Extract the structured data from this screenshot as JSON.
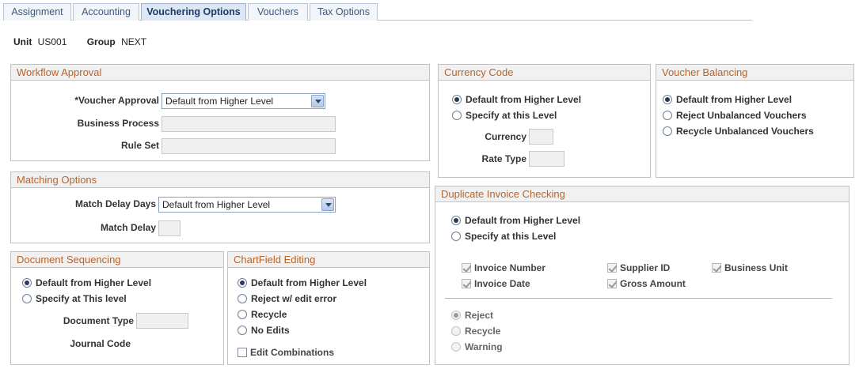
{
  "tabs": [
    {
      "label": "Assignment"
    },
    {
      "label": "Accounting"
    },
    {
      "label": "Vouchering Options"
    },
    {
      "label": "Vouchers"
    },
    {
      "label": "Tax Options"
    }
  ],
  "header": {
    "unit_label": "Unit",
    "unit_value": "US001",
    "group_label": "Group",
    "group_value": "NEXT"
  },
  "workflow": {
    "title": "Workflow Approval",
    "voucher_approval_label": "*Voucher Approval",
    "voucher_approval_value": "Default from Higher Level",
    "business_process_label": "Business Process",
    "rule_set_label": "Rule Set"
  },
  "matching": {
    "title": "Matching Options",
    "delay_days_label": "Match Delay Days",
    "delay_days_value": "Default from Higher Level",
    "delay_label": "Match Delay"
  },
  "docseq": {
    "title": "Document Sequencing",
    "opt_default": "Default from Higher Level",
    "opt_specify": "Specify at This level",
    "doc_type_label": "Document Type",
    "journal_code_label": "Journal Code"
  },
  "chartfield": {
    "title": "ChartField Editing",
    "opt_default": "Default from Higher Level",
    "opt_reject": "Reject w/ edit error",
    "opt_recycle": "Recycle",
    "opt_noedits": "No Edits",
    "edit_combinations": "Edit Combinations"
  },
  "currency": {
    "title": "Currency Code",
    "opt_default": "Default from Higher Level",
    "opt_specify": "Specify at this Level",
    "currency_label": "Currency",
    "rate_type_label": "Rate Type"
  },
  "balancing": {
    "title": "Voucher Balancing",
    "opt_default": "Default from Higher Level",
    "opt_reject": "Reject Unbalanced Vouchers",
    "opt_recycle": "Recycle Unbalanced Vouchers"
  },
  "duplicate": {
    "title": "Duplicate Invoice Checking",
    "opt_default": "Default from Higher Level",
    "opt_specify": "Specify at this Level",
    "invoice_number": "Invoice Number",
    "supplier_id": "Supplier ID",
    "business_unit": "Business Unit",
    "invoice_date": "Invoice Date",
    "gross_amount": "Gross Amount",
    "action_reject": "Reject",
    "action_recycle": "Recycle",
    "action_warning": "Warning"
  }
}
